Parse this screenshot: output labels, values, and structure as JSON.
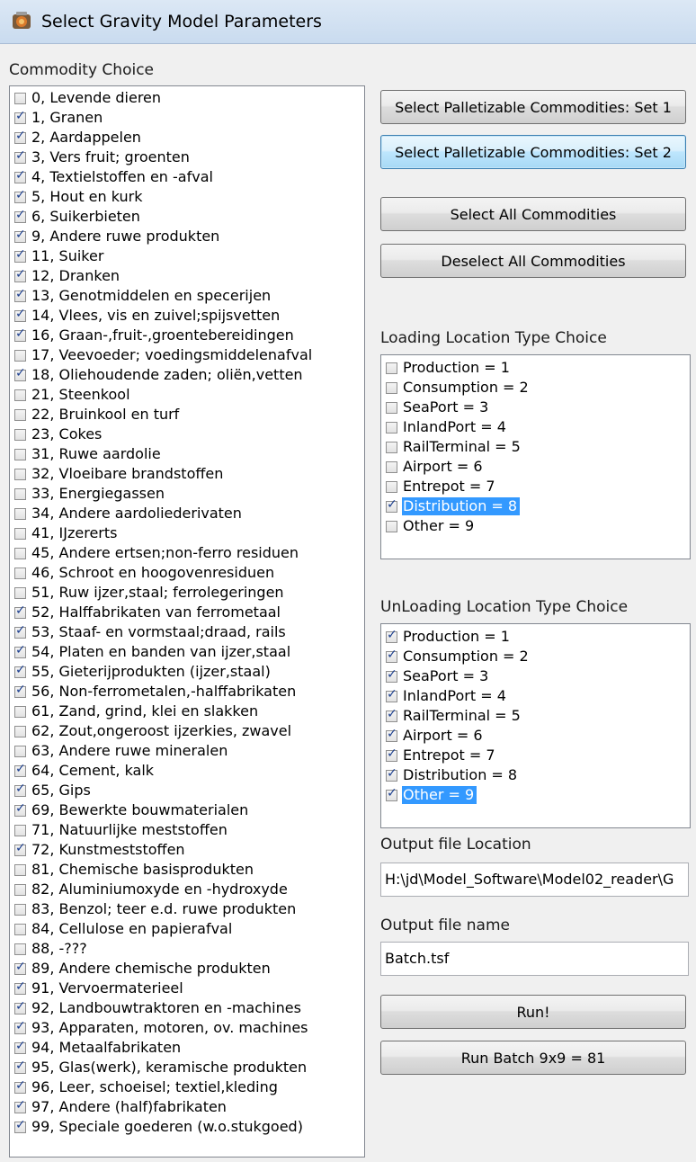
{
  "window": {
    "title": "Select Gravity Model Parameters"
  },
  "commodity": {
    "label": "Commodity Choice",
    "items": [
      {
        "text": "0, Levende dieren",
        "checked": false
      },
      {
        "text": "1, Granen",
        "checked": true
      },
      {
        "text": "2, Aardappelen",
        "checked": true
      },
      {
        "text": "3, Vers fruit; groenten",
        "checked": true
      },
      {
        "text": "4, Textielstoffen en -afval",
        "checked": true
      },
      {
        "text": "5, Hout en kurk",
        "checked": true
      },
      {
        "text": "6, Suikerbieten",
        "checked": true
      },
      {
        "text": "9, Andere ruwe produkten",
        "checked": true
      },
      {
        "text": "11, Suiker",
        "checked": true
      },
      {
        "text": "12, Dranken",
        "checked": true
      },
      {
        "text": "13, Genotmiddelen en specerijen",
        "checked": true
      },
      {
        "text": "14, Vlees, vis en zuivel;spijsvetten",
        "checked": true
      },
      {
        "text": "16, Graan-,fruit-,groentebereidingen",
        "checked": true
      },
      {
        "text": "17, Veevoeder; voedingsmiddelenafval",
        "checked": false
      },
      {
        "text": "18, Oliehoudende zaden; oliën,vetten",
        "checked": true
      },
      {
        "text": "21, Steenkool",
        "checked": false
      },
      {
        "text": "22, Bruinkool en turf",
        "checked": false
      },
      {
        "text": "23, Cokes",
        "checked": false
      },
      {
        "text": "31, Ruwe aardolie",
        "checked": false
      },
      {
        "text": "32, Vloeibare brandstoffen",
        "checked": false
      },
      {
        "text": "33, Energiegassen",
        "checked": false
      },
      {
        "text": "34, Andere aardoliederivaten",
        "checked": false
      },
      {
        "text": "41, IJzererts",
        "checked": false
      },
      {
        "text": "45, Andere ertsen;non-ferro residuen",
        "checked": false
      },
      {
        "text": "46, Schroot en hoogovenresiduen",
        "checked": false
      },
      {
        "text": "51, Ruw ijzer,staal; ferrolegeringen",
        "checked": false
      },
      {
        "text": "52, Halffabrikaten van ferrometaal",
        "checked": true
      },
      {
        "text": "53, Staaf- en vormstaal;draad, rails",
        "checked": true
      },
      {
        "text": "54, Platen en banden van ijzer,staal",
        "checked": true
      },
      {
        "text": "55, Gieterijprodukten (ijzer,staal)",
        "checked": true
      },
      {
        "text": "56, Non-ferrometalen,-halffabrikaten",
        "checked": true
      },
      {
        "text": "61, Zand, grind, klei en slakken",
        "checked": false
      },
      {
        "text": "62, Zout,ongeroost ijzerkies, zwavel",
        "checked": false
      },
      {
        "text": "63, Andere ruwe mineralen",
        "checked": false
      },
      {
        "text": "64, Cement, kalk",
        "checked": true
      },
      {
        "text": "65, Gips",
        "checked": true
      },
      {
        "text": "69, Bewerkte bouwmaterialen",
        "checked": true
      },
      {
        "text": "71, Natuurlijke meststoffen",
        "checked": false
      },
      {
        "text": "72, Kunstmeststoffen",
        "checked": true
      },
      {
        "text": "81, Chemische basisprodukten",
        "checked": false
      },
      {
        "text": "82, Aluminiumoxyde en -hydroxyde",
        "checked": false
      },
      {
        "text": "83, Benzol; teer e.d. ruwe produkten",
        "checked": false
      },
      {
        "text": "84, Cellulose en papierafval",
        "checked": false
      },
      {
        "text": "88, -???",
        "checked": false
      },
      {
        "text": "89, Andere chemische produkten",
        "checked": true
      },
      {
        "text": "91, Vervoermaterieel",
        "checked": true
      },
      {
        "text": "92, Landbouwtraktoren en -machines",
        "checked": true
      },
      {
        "text": "93, Apparaten, motoren, ov. machines",
        "checked": true
      },
      {
        "text": "94, Metaalfabrikaten",
        "checked": true
      },
      {
        "text": "95, Glas(werk), keramische produkten",
        "checked": true
      },
      {
        "text": "96, Leer, schoeisel; textiel,kleding",
        "checked": true
      },
      {
        "text": "97, Andere (half)fabrikaten",
        "checked": true
      },
      {
        "text": "99, Speciale goederen (w.o.stukgoed)",
        "checked": true
      }
    ]
  },
  "buttons": {
    "set1": "Select Palletizable Commodities: Set 1",
    "set2": "Select Palletizable Commodities: Set 2",
    "select_all": "Select All Commodities",
    "deselect_all": "Deselect All Commodities",
    "run": "Run!",
    "run_batch": "Run Batch 9x9 = 81"
  },
  "loading": {
    "label": "Loading Location Type Choice",
    "items": [
      {
        "text": "Production = 1",
        "checked": false,
        "selected": false
      },
      {
        "text": "Consumption = 2",
        "checked": false,
        "selected": false
      },
      {
        "text": "SeaPort = 3",
        "checked": false,
        "selected": false
      },
      {
        "text": "InlandPort = 4",
        "checked": false,
        "selected": false
      },
      {
        "text": "RailTerminal = 5",
        "checked": false,
        "selected": false
      },
      {
        "text": "Airport = 6",
        "checked": false,
        "selected": false
      },
      {
        "text": "Entrepot = 7",
        "checked": false,
        "selected": false
      },
      {
        "text": "Distribution = 8",
        "checked": true,
        "selected": true
      },
      {
        "text": "Other = 9",
        "checked": false,
        "selected": false
      }
    ]
  },
  "unloading": {
    "label": "UnLoading Location Type Choice",
    "items": [
      {
        "text": "Production = 1",
        "checked": true,
        "selected": false
      },
      {
        "text": "Consumption = 2",
        "checked": true,
        "selected": false
      },
      {
        "text": "SeaPort = 3",
        "checked": true,
        "selected": false
      },
      {
        "text": "InlandPort = 4",
        "checked": true,
        "selected": false
      },
      {
        "text": "RailTerminal = 5",
        "checked": true,
        "selected": false
      },
      {
        "text": "Airport = 6",
        "checked": true,
        "selected": false
      },
      {
        "text": "Entrepot = 7",
        "checked": true,
        "selected": false
      },
      {
        "text": "Distribution = 8",
        "checked": true,
        "selected": false
      },
      {
        "text": "Other = 9",
        "checked": true,
        "selected": true
      }
    ]
  },
  "output": {
    "location_label": "Output file Location",
    "location_value": "H:\\jd\\Model_Software\\Model02_reader\\G",
    "name_label": "Output file name",
    "name_value": "Batch.tsf"
  }
}
